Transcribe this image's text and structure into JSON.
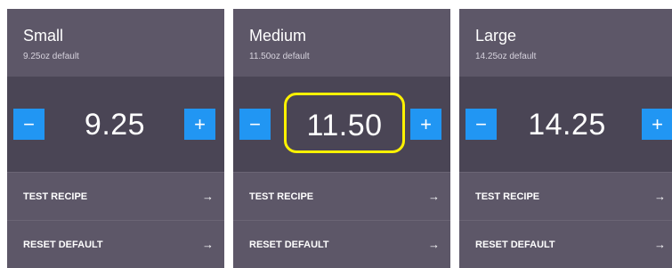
{
  "sizes": [
    {
      "name": "Small",
      "default_text": "9.25oz default",
      "value": "9.25",
      "minus_label": "−",
      "plus_label": "+",
      "actions": [
        {
          "label": "TEST RECIPE",
          "arrow": "→"
        },
        {
          "label": "RESET DEFAULT",
          "arrow": "→"
        }
      ]
    },
    {
      "name": "Medium",
      "default_text": "11.50oz default",
      "value": "11.50",
      "minus_label": "−",
      "plus_label": "+",
      "actions": [
        {
          "label": "TEST RECIPE",
          "arrow": "→"
        },
        {
          "label": "RESET DEFAULT",
          "arrow": "→"
        }
      ]
    },
    {
      "name": "Large",
      "default_text": "14.25oz default",
      "value": "14.25",
      "minus_label": "−",
      "plus_label": "+",
      "actions": [
        {
          "label": "TEST RECIPE",
          "arrow": "→"
        },
        {
          "label": "RESET DEFAULT",
          "arrow": "→"
        }
      ]
    }
  ],
  "colors": {
    "card_bg": "#5d5768",
    "stepper_bg": "#4a4555",
    "button_accent": "#2196f3",
    "highlight_outline": "#fff200"
  },
  "icons": {
    "minus": "minus-icon",
    "plus": "plus-icon",
    "arrow": "arrow-right-icon"
  }
}
